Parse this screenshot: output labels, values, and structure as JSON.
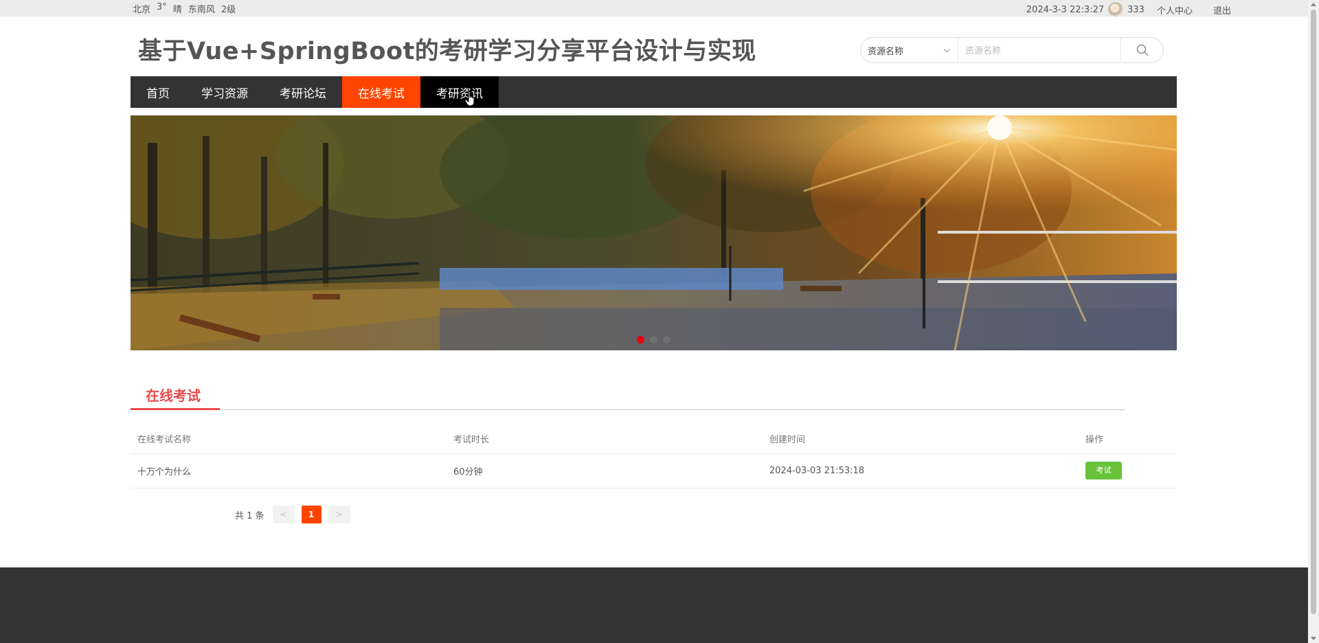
{
  "topbar": {
    "weather": [
      "北京",
      "3°",
      "晴",
      "东南风",
      "2级"
    ],
    "datetime": "2024-3-3 22:3:27",
    "username": "333",
    "personal_center": "个人中心",
    "logout": "退出"
  },
  "header": {
    "title": "基于Vue+SpringBoot的考研学习分享平台设计与实现"
  },
  "search": {
    "select_value": "资源名称",
    "placeholder": "资源名称",
    "icon": "search-icon"
  },
  "nav": {
    "items": [
      {
        "label": "首页"
      },
      {
        "label": "学习资源"
      },
      {
        "label": "考研论坛"
      },
      {
        "label": "在线考试",
        "state": "active"
      },
      {
        "label": "考研资讯",
        "state": "hover"
      }
    ]
  },
  "banner": {
    "dots_count": 3,
    "active_dot": 1
  },
  "section": {
    "title": "在线考试"
  },
  "table": {
    "columns": [
      "在线考试名称",
      "考试时长",
      "创建时间",
      "操作"
    ],
    "rows": [
      {
        "name": "十万个为什么",
        "duration": "60分钟",
        "created": "2024-03-03 21:53:18",
        "action": "考试"
      }
    ]
  },
  "pagination": {
    "total_text": "共 1 条",
    "prev": "<",
    "current": "1",
    "next": ">"
  },
  "colors": {
    "accent": "#ff4400",
    "nav_bg": "#333333",
    "section_title": "#e94b4b",
    "exam_button": "#67c23a",
    "active_dot": "#e60012",
    "footer_bg": "#333333"
  }
}
